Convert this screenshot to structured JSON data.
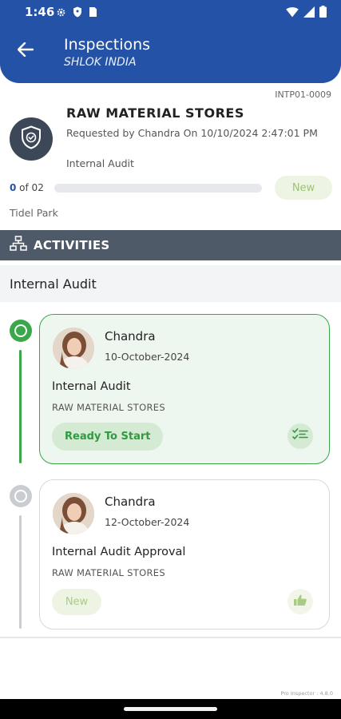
{
  "status_bar": {
    "time": "1:46"
  },
  "header": {
    "title": "Inspections",
    "subtitle": "SHLOK INDIA"
  },
  "request": {
    "id": "INTP01-0009",
    "store": "RAW MATERIAL STORES",
    "requested_line": "Requested by Chandra On  10/10/2024  2:47:01 PM",
    "type": "Internal Audit",
    "progress_current": "0",
    "progress_rest": " of 02",
    "progress_fraction": 0,
    "status": "New",
    "location": "Tidel Park"
  },
  "activities": {
    "header": "ACTIVITIES",
    "section": "Internal Audit",
    "items": [
      {
        "name": "Chandra",
        "date": "10-October-2024",
        "title": "Internal Audit",
        "store": "RAW MATERIAL STORES",
        "status": "Ready To Start",
        "icon": "checklist-icon"
      },
      {
        "name": "Chandra",
        "date": "12-October-2024",
        "title": "Internal Audit Approval",
        "store": "RAW MATERIAL STORES",
        "status": "New",
        "icon": "thumbs-up-icon"
      }
    ]
  },
  "footer": {
    "version": "Pro Inspector : 4.8.0"
  },
  "colors": {
    "primary": "#2452a7",
    "success": "#3aa84a",
    "slate": "#4f5a69"
  }
}
